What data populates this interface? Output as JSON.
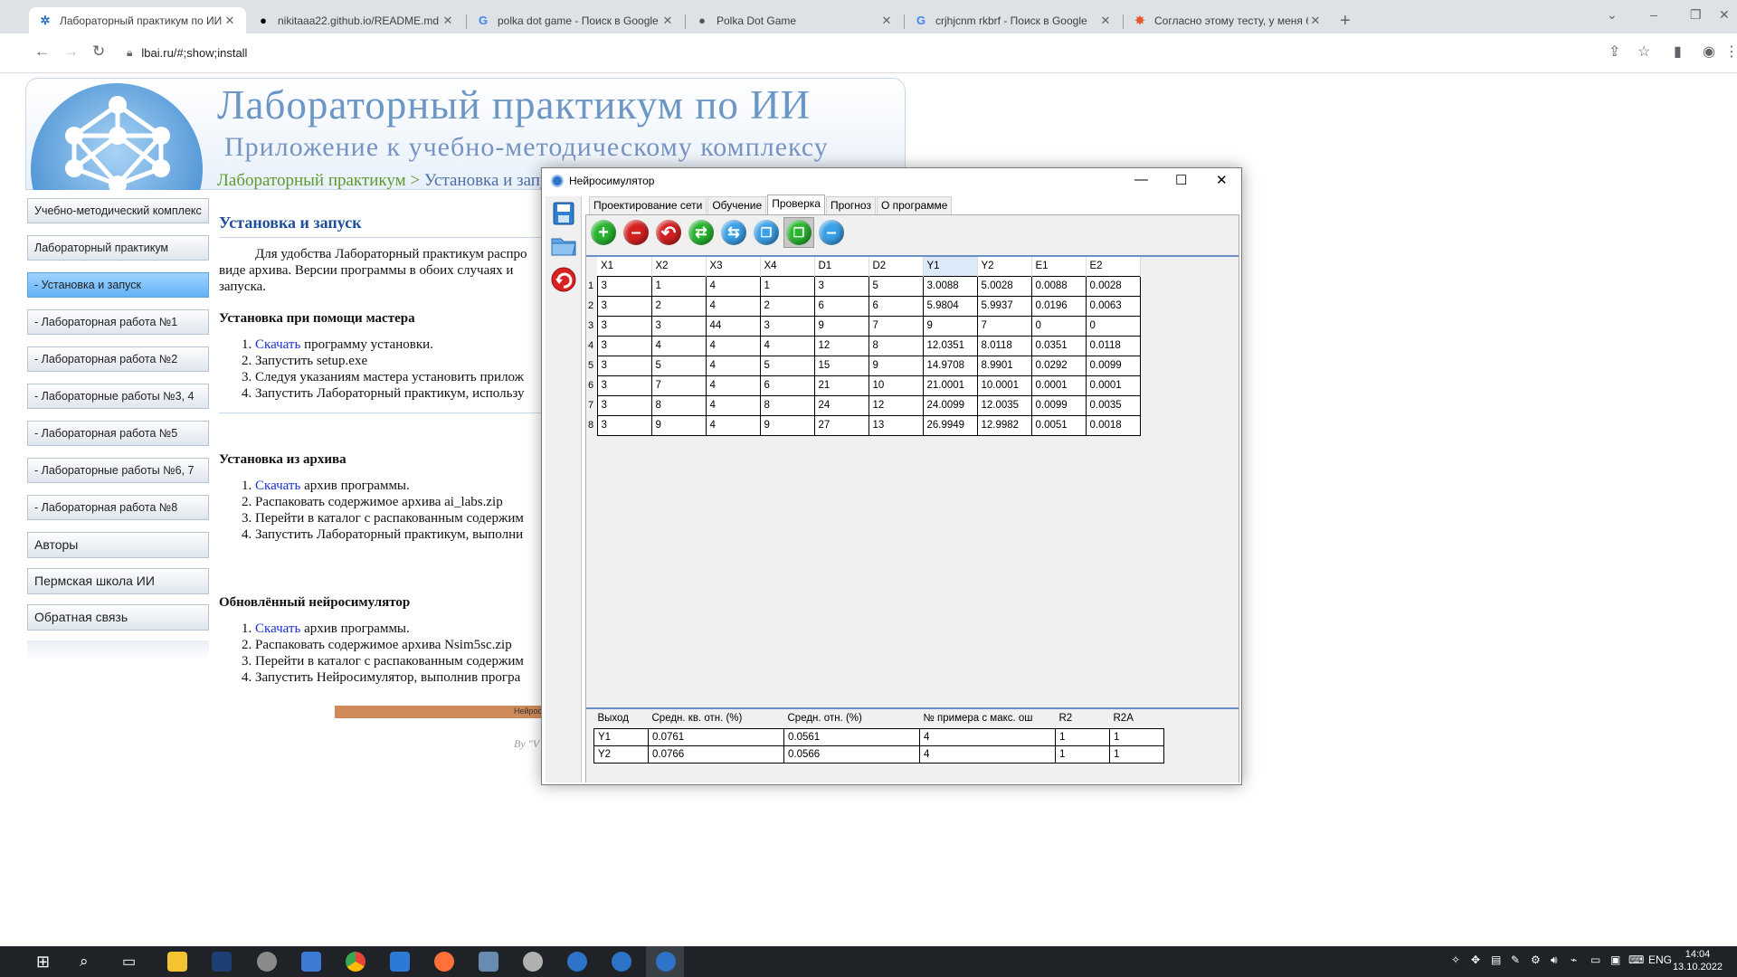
{
  "browser": {
    "tabs": [
      {
        "title": "Лабораторный практикум по ИИ",
        "icon": "network-logo-icon",
        "active": true
      },
      {
        "title": "nikitaaa22.github.io/README.md",
        "icon": "github-icon",
        "active": false
      },
      {
        "title": "polka dot game - Поиск в Google",
        "icon": "google-icon",
        "active": false
      },
      {
        "title": "Polka Dot Game",
        "icon": "dot-icon",
        "active": false
      },
      {
        "title": "crjhjcnm rkbrf - Поиск в Google",
        "icon": "google-icon",
        "active": false
      },
      {
        "title": "Согласно этому тесту, у меня бо...",
        "icon": "flame-icon",
        "active": false
      }
    ],
    "url": "lbai.ru/#;show;install"
  },
  "site": {
    "title": "Лабораторный практикум по ИИ",
    "subtitle": "Приложение к учебно-методическому комплексу",
    "breadcrumb_root": "Лабораторный практикум",
    "breadcrumb_sep": " > ",
    "breadcrumb_current": "Установка и запуск"
  },
  "menu": [
    {
      "label": "Учебно-методический комплекс",
      "active": false
    },
    {
      "label": "Лабораторный практикум",
      "active": false
    },
    {
      "label": "- Установка и запуск",
      "active": true
    },
    {
      "label": "- Лабораторная работа №1",
      "active": false
    },
    {
      "label": "- Лабораторная работа №2",
      "active": false
    },
    {
      "label": "- Лабораторные работы №3, 4",
      "active": false
    },
    {
      "label": "- Лабораторная работа №5",
      "active": false
    },
    {
      "label": "- Лабораторные работы №6, 7",
      "active": false
    },
    {
      "label": "- Лабораторная работа №8",
      "active": false
    },
    {
      "label": "Авторы",
      "active": false
    },
    {
      "label": "Пермская школа ИИ",
      "active": false
    },
    {
      "label": "Обратная связь",
      "active": false
    }
  ],
  "content": {
    "heading": "Установка и запуск",
    "intro": [
      "Для удобства Лабораторный практикум распро",
      "виде архива. Версии программы в обоих случаях и",
      "запуска."
    ],
    "section1": {
      "title": "Установка при помощи мастера",
      "steps": [
        {
          "link": "Скачать",
          "text": " программу установки."
        },
        {
          "link": "",
          "text": "Запустить setup.exe"
        },
        {
          "link": "",
          "text": "Следуя указаниям мастера установить прилож"
        },
        {
          "link": "",
          "text": "Запустить Лабораторный практикум, использу"
        }
      ]
    },
    "section2": {
      "title": "Установка из архива",
      "steps": [
        {
          "link": "Скачать",
          "text": " архив программы."
        },
        {
          "link": "",
          "text": "Распаковать содержимое архива ai_labs.zip"
        },
        {
          "link": "",
          "text": "Перейти в каталог с распакованным содержим"
        },
        {
          "link": "",
          "text": "Запустить Лабораторный практикум, выполни"
        }
      ]
    },
    "section3": {
      "title": "Обновлённый нейросимулятор",
      "steps": [
        {
          "link": "Скачать",
          "text": " архив программы."
        },
        {
          "link": "",
          "text": "Распаковать содержимое архива Nsim5sc.zip"
        },
        {
          "link": "",
          "text": "Перейти в каталог с распакованным содержим"
        },
        {
          "link": "",
          "text": "Запустить Нейросимулятор, выполнив програ"
        }
      ]
    },
    "footer_img_text": "Нейрос",
    "footer_by": "By \"V"
  },
  "app": {
    "title": "Нейросимулятор",
    "tabs": [
      "Проектирование сети",
      "Обучение",
      "Проверка",
      "Прогноз",
      "О программе"
    ],
    "active_tab": 2,
    "grid": {
      "columns": [
        "X1",
        "X2",
        "X3",
        "X4",
        "D1",
        "D2",
        "Y1",
        "Y2",
        "E1",
        "E2"
      ],
      "selected_column": "Y1",
      "rows": [
        {
          "n": "1",
          "cells": [
            "3",
            "1",
            "4",
            "1",
            "3",
            "5",
            "3.0088",
            "5.0028",
            "0.0088",
            "0.0028"
          ]
        },
        {
          "n": "2",
          "cells": [
            "3",
            "2",
            "4",
            "2",
            "6",
            "6",
            "5.9804",
            "5.9937",
            "0.0196",
            "0.0063"
          ]
        },
        {
          "n": "3",
          "cells": [
            "3",
            "3",
            "44",
            "3",
            "9",
            "7",
            "9",
            "7",
            "0",
            "0"
          ]
        },
        {
          "n": "4",
          "cells": [
            "3",
            "4",
            "4",
            "4",
            "12",
            "8",
            "12.0351",
            "8.0118",
            "0.0351",
            "0.0118"
          ]
        },
        {
          "n": "5",
          "cells": [
            "3",
            "5",
            "4",
            "5",
            "15",
            "9",
            "14.9708",
            "8.9901",
            "0.0292",
            "0.0099"
          ]
        },
        {
          "n": "6",
          "cells": [
            "3",
            "7",
            "4",
            "6",
            "21",
            "10",
            "21.0001",
            "10.0001",
            "0.0001",
            "0.0001"
          ]
        },
        {
          "n": "7",
          "cells": [
            "3",
            "8",
            "4",
            "8",
            "24",
            "12",
            "24.0099",
            "12.0035",
            "0.0099",
            "0.0035"
          ]
        },
        {
          "n": "8",
          "cells": [
            "3",
            "9",
            "4",
            "9",
            "27",
            "13",
            "26.9949",
            "12.9982",
            "0.0051",
            "0.0018"
          ]
        }
      ]
    },
    "results": {
      "columns": [
        "Выход",
        "Средн. кв. отн. (%)",
        "Средн. отн. (%)",
        "№ примера с макс. ош",
        "R2",
        "R2A"
      ],
      "rows": [
        [
          "Y1",
          "0.0761",
          "0.0561",
          "4",
          "1",
          "1"
        ],
        [
          "Y2",
          "0.0766",
          "0.0566",
          "4",
          "1",
          "1"
        ]
      ]
    }
  },
  "taskbar": {
    "lang": "ENG",
    "time": "14:04",
    "date": "13.10.2022"
  }
}
